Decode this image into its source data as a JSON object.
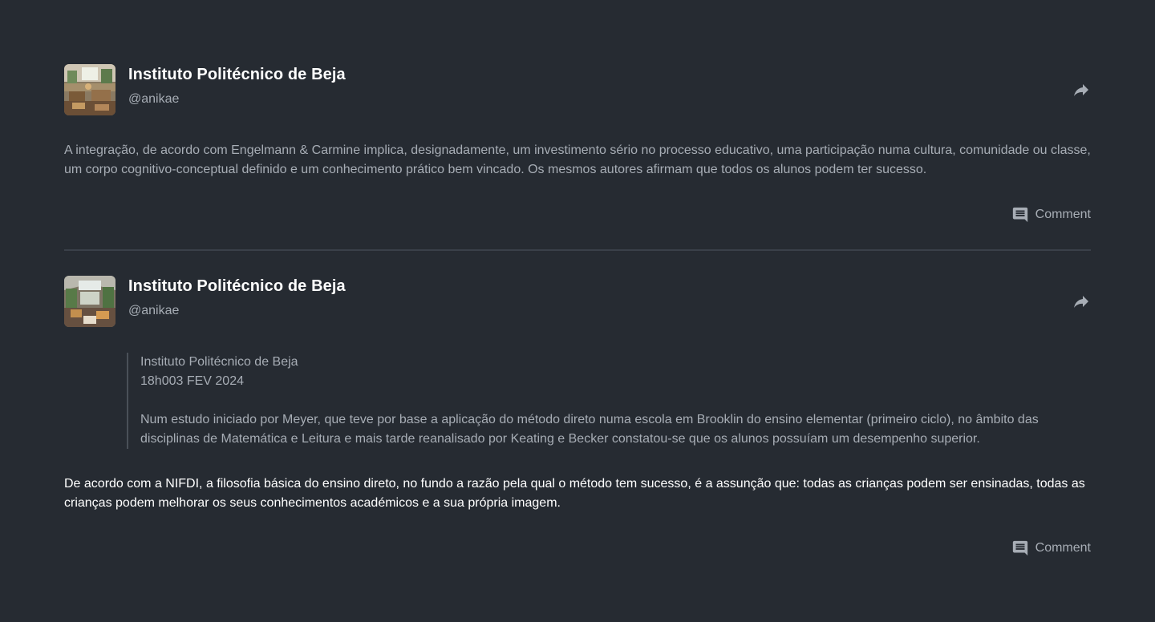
{
  "posts": [
    {
      "author": {
        "name": "Instituto Politécnico de Beja",
        "handle": "@anikae"
      },
      "body": "A integração, de acordo com Engelmann & Carmine implica, designadamente, um investimento sério no processo educativo, uma participação numa cultura, comunidade ou classe, um corpo cognitivo-conceptual definido e um conhecimento prático bem vincado. Os mesmos autores afirmam que todos os alunos podem ter sucesso.",
      "comment_label": "Comment"
    },
    {
      "author": {
        "name": "Instituto Politécnico de Beja",
        "handle": "@anikae"
      },
      "quote": {
        "author": "Instituto Politécnico de Beja",
        "date": "18h003 FEV 2024",
        "text": "Num estudo iniciado por Meyer, que teve por base a aplicação do método direto numa escola em Brooklin do ensino elementar (primeiro ciclo), no âmbito das disciplinas de Matemática e Leitura e mais tarde reanalisado por Keating e Becker constatou-se que os alunos possuíam um desempenho superior."
      },
      "body": "De acordo com a NIFDI, a filosofia básica do ensino direto, no fundo a razão pela qual o método tem sucesso, é a assunção que: todas as crianças podem ser ensinadas, todas as crianças podem melhorar os seus conhecimentos académicos e a sua própria imagem.",
      "comment_label": "Comment"
    }
  ],
  "icons": {
    "share": "share-arrow-icon",
    "comment": "comment-icon"
  },
  "colors": {
    "background": "#262b32",
    "primary_text": "#ffffff",
    "secondary_text": "#a7adb5",
    "divider": "#3a4049"
  }
}
